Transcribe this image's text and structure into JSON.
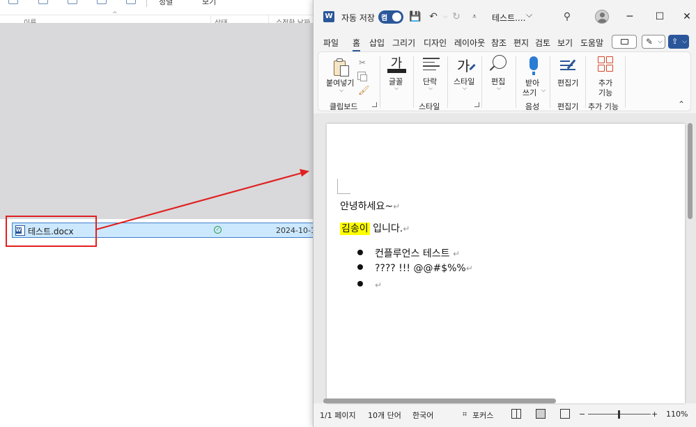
{
  "explorer": {
    "toolbar": {
      "sort_label": "정렬",
      "view_label": "보기"
    },
    "columns": {
      "name": "이름",
      "status": "상태",
      "modified": "수정한 날짜"
    },
    "file": {
      "name": "테스트.docx",
      "date": "2024-10-1"
    }
  },
  "word": {
    "titlebar": {
      "autosave_label": "자동 저장",
      "toggle_state": "켬",
      "doc_title": "테스트....",
      "caret": "⌵"
    },
    "tabs": [
      "파일",
      "홈",
      "삽입",
      "그리기",
      "디자인",
      "레이아웃",
      "참조",
      "편지",
      "검토",
      "보기",
      "도움말"
    ],
    "active_tab": "홈",
    "ribbon": {
      "paste": "붙여넣기",
      "clipboard": "클립보드",
      "font": "글꼴",
      "font_glyph": "가",
      "paragraph": "단락",
      "styles": "스타일",
      "styles_group": "스타일",
      "style_glyph": "가",
      "editing": "편집",
      "dictate_1": "받아",
      "dictate_2": "쓰기",
      "voice": "음성",
      "editor": "편집기",
      "editor_group": "편집기",
      "addins_1": "추가",
      "addins_2": "기능",
      "addins_group": "추가 기능"
    },
    "document": {
      "line1": "안녕하세요~",
      "highlight": "김송이",
      "line2_rest": " 입니다.",
      "bullets": [
        "컨플루언스 테스트 ",
        "???? !!! @@#$%%",
        ""
      ],
      "para_mark": "↵"
    },
    "status": {
      "page": "1/1 페이지",
      "words": "10개 단어",
      "language": "한국어",
      "focus": "포커스",
      "zoom_minus": "−",
      "zoom_plus": "+",
      "zoom": "110%"
    }
  },
  "colors": {
    "word_blue": "#2b579a",
    "annotation_red": "#e02020",
    "highlight_yellow": "#ffff00",
    "selected_row": "#cce8ff"
  }
}
